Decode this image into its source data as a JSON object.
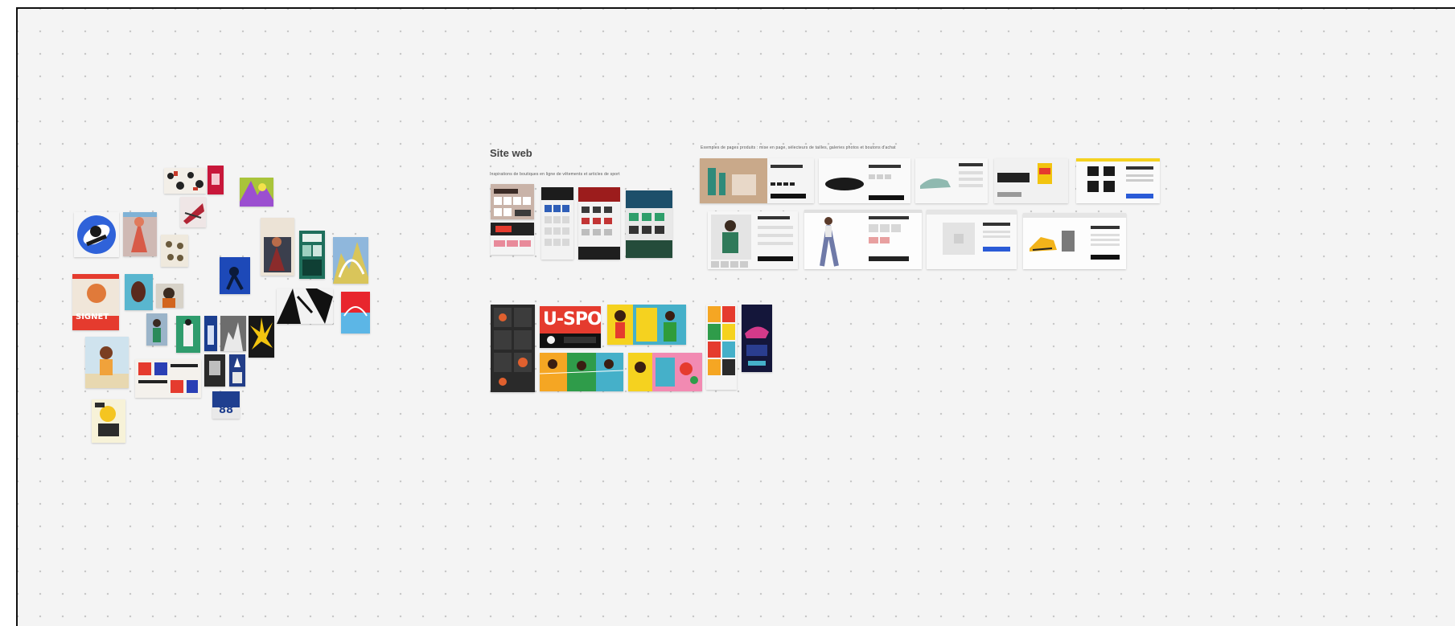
{
  "board": {
    "site_title": "Site web",
    "site_caption": "Inspirations de boutiques en ligne de vêtements et articles de sport",
    "ecom_caption": "Exemples de pages produits : mise en page, sélecteurs de tailles, galeries photos et boutons d'achat",
    "usports_text": "U-SPORTS",
    "poster_signet": "SIGNET",
    "poster_88": "88"
  },
  "colors": {
    "canvas_bg": "#f4f4f4",
    "dot": "#c6c6c6",
    "border": "#111111",
    "accent_red": "#e53b2e",
    "accent_yellow": "#f5d21f",
    "accent_blue": "#2a5bd7",
    "accent_green": "#2e9e6a"
  }
}
